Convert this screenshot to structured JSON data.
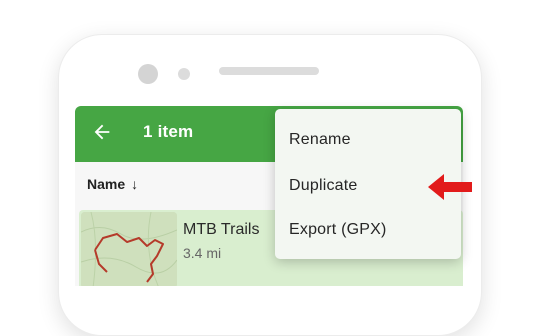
{
  "appbar": {
    "title": "1 item",
    "back_icon": "arrow-back-icon",
    "color": "#46a644"
  },
  "sort": {
    "label": "Name",
    "direction_icon": "arrow-down-icon",
    "direction_glyph": "↓"
  },
  "list": {
    "items": [
      {
        "title": "MTB Trails",
        "distance": "3.4 mi",
        "selected_color": "#d9eecf"
      }
    ]
  },
  "context_menu": {
    "items": [
      {
        "label": "Rename"
      },
      {
        "label": "Duplicate"
      },
      {
        "label": "Export (GPX)"
      }
    ]
  },
  "annotation": {
    "pointer_icon": "red-arrow-icon",
    "color": "#e21b1b"
  }
}
